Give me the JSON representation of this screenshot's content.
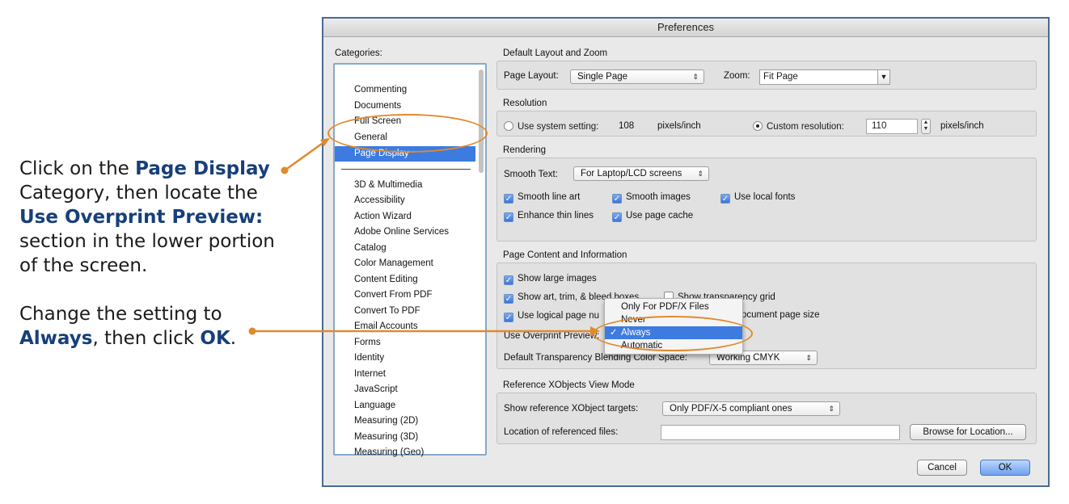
{
  "instructions": {
    "part1": {
      "t1": "Click on the ",
      "b1": "Page Display",
      "t2": " Category, then locate the ",
      "b2": "Use Overprint Preview:",
      "t3": " section in the lower portion of the screen."
    },
    "part2": {
      "t1": "Change the setting to ",
      "b1": "Always",
      "t2": ", then click ",
      "b2": "OK",
      "t3": "."
    }
  },
  "window": {
    "title": "Preferences"
  },
  "categories": {
    "label": "Categories:",
    "top_items": [
      "Commenting",
      "Documents",
      "Full Screen",
      "General",
      "Page Display"
    ],
    "selected": "Page Display",
    "items": [
      "3D & Multimedia",
      "Accessibility",
      "Action Wizard",
      "Adobe Online Services",
      "Catalog",
      "Color Management",
      "Content Editing",
      "Convert From PDF",
      "Convert To PDF",
      "Email Accounts",
      "Forms",
      "Identity",
      "Internet",
      "JavaScript",
      "Language",
      "Measuring (2D)",
      "Measuring (3D)",
      "Measuring (Geo)"
    ]
  },
  "layout_zoom": {
    "title": "Default Layout and Zoom",
    "page_layout_label": "Page Layout:",
    "page_layout_value": "Single Page",
    "zoom_label": "Zoom:",
    "zoom_value": "Fit Page"
  },
  "resolution": {
    "title": "Resolution",
    "system_label": "Use system setting:",
    "system_value": "108",
    "system_unit": "pixels/inch",
    "custom_label": "Custom resolution:",
    "custom_value": "110",
    "custom_unit": "pixels/inch"
  },
  "rendering": {
    "title": "Rendering",
    "smooth_text_label": "Smooth Text:",
    "smooth_text_value": "For Laptop/LCD screens",
    "smooth_line_art": "Smooth line art",
    "smooth_images": "Smooth images",
    "use_local_fonts": "Use local fonts",
    "enhance_thin_lines": "Enhance thin lines",
    "use_page_cache": "Use page cache"
  },
  "page_content": {
    "title": "Page Content and Information",
    "show_large_images": "Show large images",
    "show_art_trim": "Show art, trim, & bleed boxes",
    "show_transparency_grid": "Show transparency grid",
    "use_logical_page": "Use logical page nu",
    "document_page_size": "ocument page size",
    "overprint_label": "Use Overprint Preview:",
    "blending_label": "Default Transparency Blending Color Space:",
    "blending_value": "Working CMYK"
  },
  "overprint_menu": {
    "options": [
      "Only For PDF/X Files",
      "Never",
      "Always",
      "Automatic"
    ],
    "selected": "Always",
    "check": "✓"
  },
  "xobjects": {
    "title": "Reference XObjects View Mode",
    "targets_label": "Show reference XObject targets:",
    "targets_value": "Only PDF/X-5 compliant ones",
    "location_label": "Location of referenced files:",
    "location_value": "",
    "browse_label": "Browse for Location..."
  },
  "buttons": {
    "cancel": "Cancel",
    "ok": "OK"
  },
  "colors": {
    "accent": "#3d7be0",
    "annotation": "#e08a2e",
    "heading": "#173f7a"
  },
  "glyphs": {
    "updown": "⇕",
    "down": "▼",
    "check": "✓"
  }
}
